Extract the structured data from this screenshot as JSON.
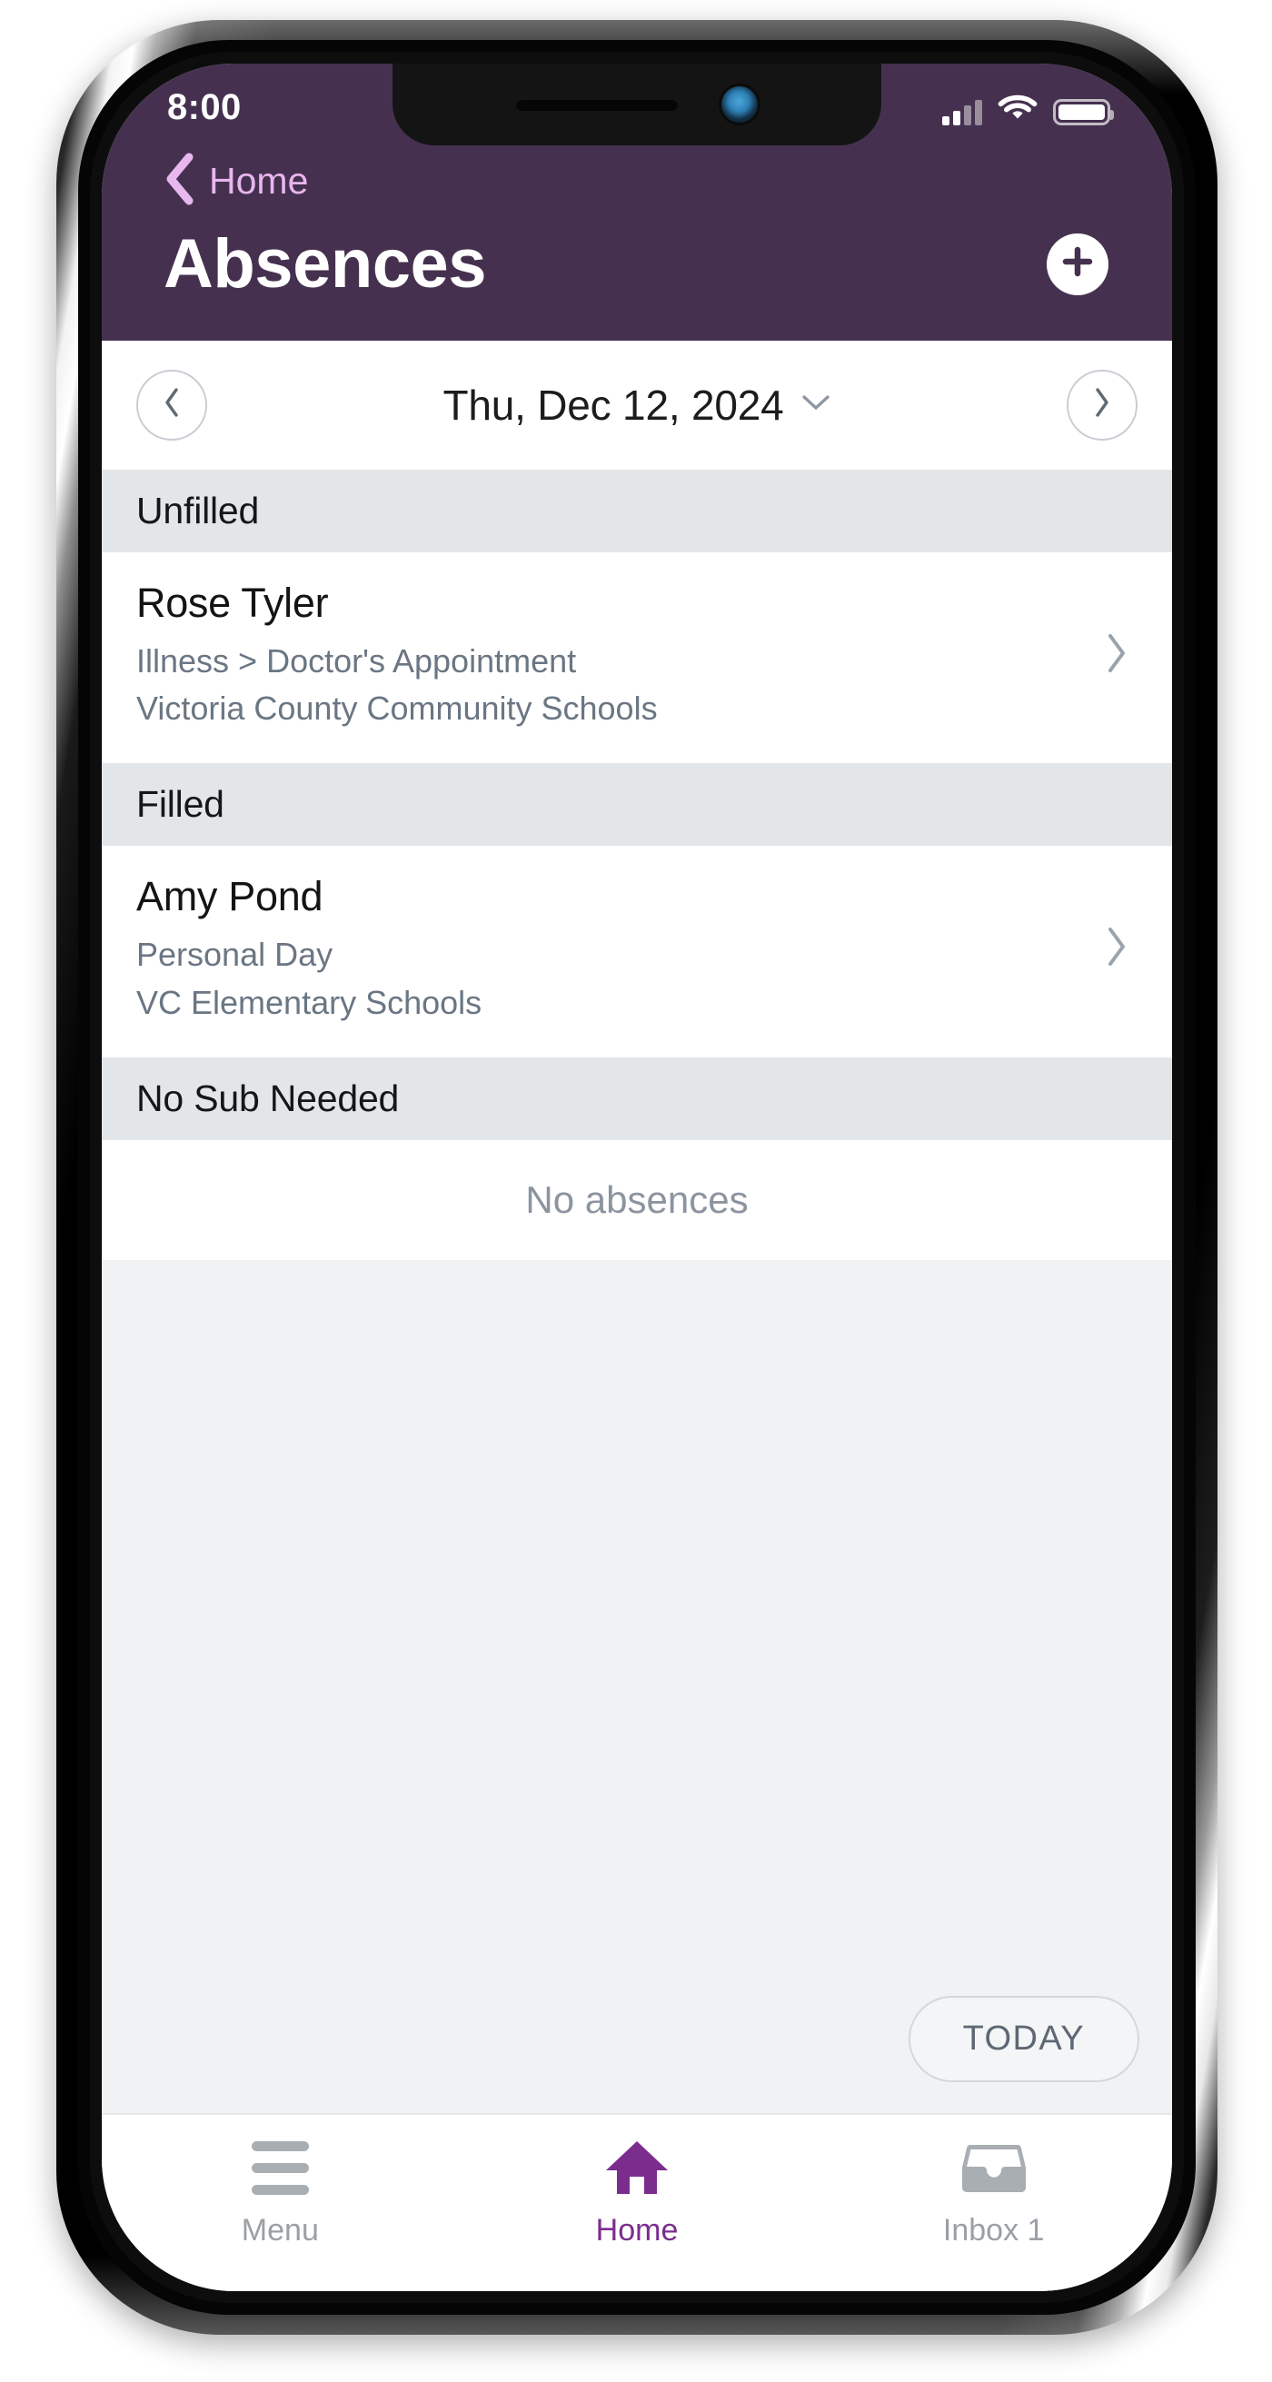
{
  "theme": {
    "header_purple": "#45314F",
    "accent_purple": "#7B2D8E",
    "back_link_pink": "#E8B7EE",
    "section_bg": "#E3E6E9",
    "page_bg": "#F1F2F4",
    "muted_text": "#6B7683"
  },
  "status_bar": {
    "time": "8:00",
    "signal_icon": "cellular-signal-icon",
    "wifi_icon": "wifi-icon",
    "battery_icon": "battery-icon"
  },
  "header": {
    "back_icon": "chevron-left-icon",
    "back_label": "Home",
    "title": "Absences",
    "add_icon": "plus-circle-icon"
  },
  "date_bar": {
    "prev_icon": "chevron-left-icon",
    "next_icon": "chevron-right-icon",
    "current_date": "Thu, Dec 12, 2024",
    "dropdown_icon": "chevron-down-icon"
  },
  "sections": [
    {
      "title": "Unfilled",
      "empty": false,
      "empty_text": "",
      "rows": [
        {
          "name": "Rose Tyler",
          "reason": "Illness > Doctor's Appointment",
          "school": "Victoria County Community Schools",
          "chevron_icon": "chevron-right-icon"
        }
      ]
    },
    {
      "title": "Filled",
      "empty": false,
      "empty_text": "",
      "rows": [
        {
          "name": "Amy Pond",
          "reason": "Personal Day",
          "school": "VC Elementary Schools",
          "chevron_icon": "chevron-right-icon"
        }
      ]
    },
    {
      "title": "No Sub Needed",
      "empty": true,
      "empty_text": "No absences",
      "rows": []
    }
  ],
  "today_button": {
    "label": "TODAY"
  },
  "tab_bar": {
    "tabs": [
      {
        "label": "Menu",
        "icon": "hamburger-menu-icon",
        "active": false
      },
      {
        "label": "Home",
        "icon": "home-icon",
        "active": true
      },
      {
        "label": "Inbox 1",
        "icon": "inbox-icon",
        "active": false
      }
    ]
  }
}
